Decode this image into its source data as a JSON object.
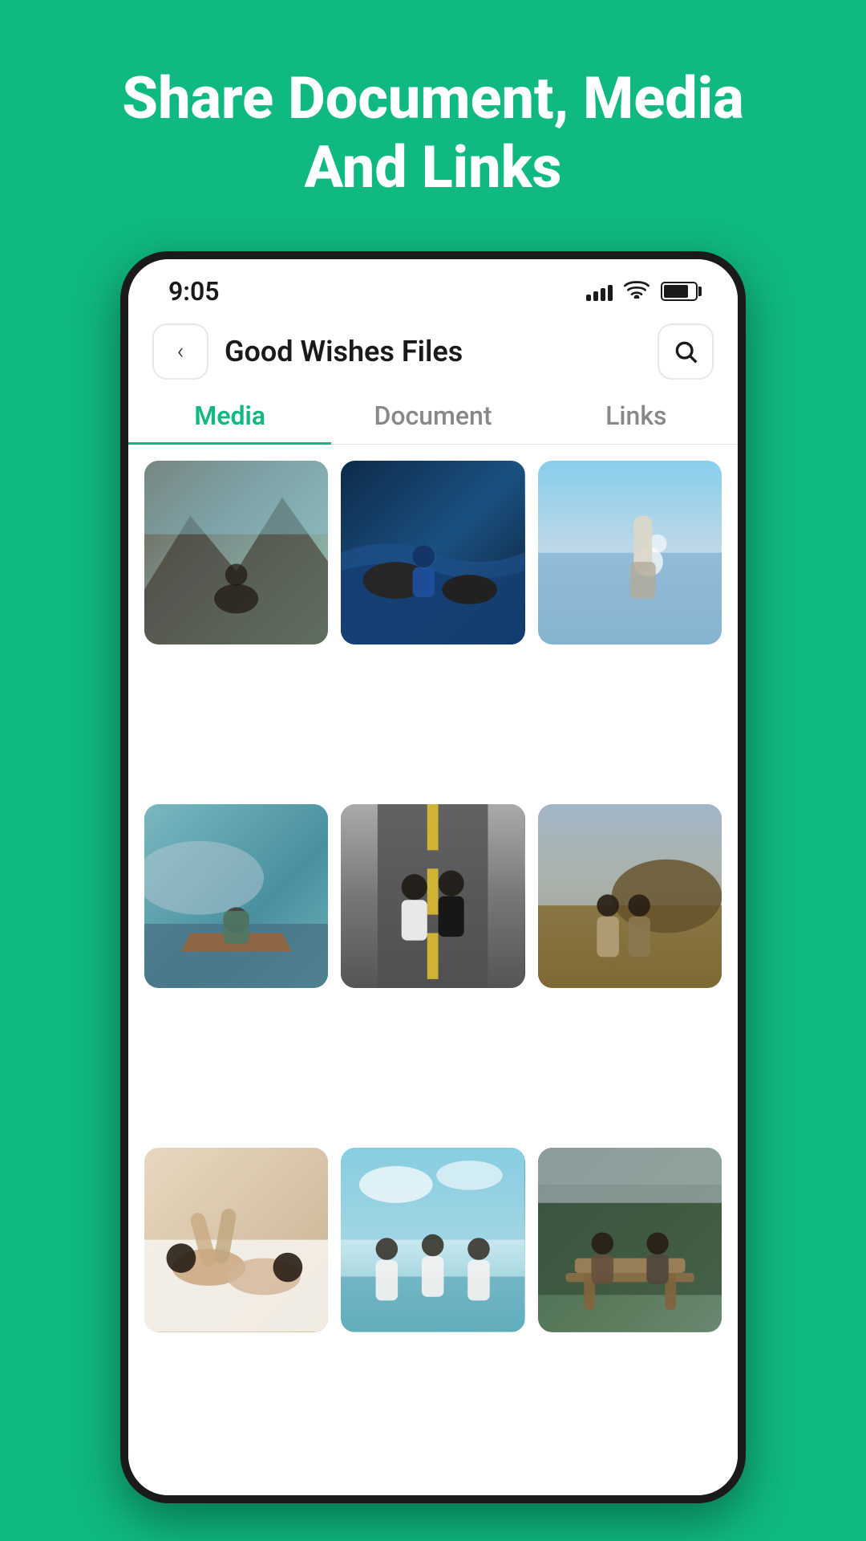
{
  "banner": {
    "title": "Share Document, Media\nAnd Links"
  },
  "statusBar": {
    "time": "9:05"
  },
  "header": {
    "title": "Good Wishes Files"
  },
  "tabs": [
    {
      "id": "media",
      "label": "Media",
      "active": true
    },
    {
      "id": "document",
      "label": "Document",
      "active": false
    },
    {
      "id": "links",
      "label": "Links",
      "active": false
    }
  ],
  "photos": [
    {
      "id": 1,
      "class": "photo-1",
      "alt": "Mountain landscape with people"
    },
    {
      "id": 2,
      "class": "photo-2",
      "alt": "Ocean rocks scene"
    },
    {
      "id": 3,
      "class": "photo-3",
      "alt": "Beach water scene"
    },
    {
      "id": 4,
      "class": "photo-4",
      "alt": "Woman in boat on lake"
    },
    {
      "id": 5,
      "class": "photo-5",
      "alt": "Two people on road"
    },
    {
      "id": 6,
      "class": "photo-6",
      "alt": "Two people in field"
    },
    {
      "id": 7,
      "class": "photo-7",
      "alt": "People lying down indoors"
    },
    {
      "id": 8,
      "class": "photo-8",
      "alt": "Group at beach"
    },
    {
      "id": 9,
      "class": "photo-9",
      "alt": "People at picnic table"
    }
  ]
}
